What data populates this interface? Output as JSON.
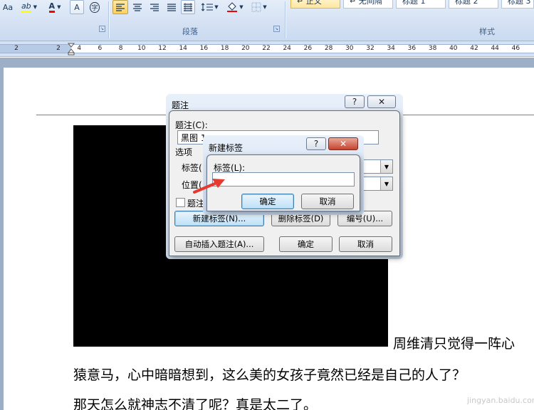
{
  "ribbon": {
    "font_group": {
      "change_case_label": "Aa",
      "highlight_label": "ab",
      "font_color_label": "A",
      "char_shading_label": "A",
      "enclose_label": "字"
    },
    "paragraph_group": {
      "label": "段落"
    },
    "styles_group": {
      "label": "样式",
      "items": [
        "↵ 正文",
        "↵ 无间隔",
        "标题 1",
        "标题 2",
        "标题 3"
      ]
    },
    "colors": {
      "highlight": "#ffff00",
      "font_color": "#ff0000",
      "selected_style": "#ffe7a1"
    }
  },
  "ruler": {
    "ticks": [
      "2",
      "2",
      "4",
      "6",
      "8",
      "10",
      "12",
      "14",
      "16",
      "18",
      "20",
      "22",
      "24",
      "26",
      "28",
      "30",
      "32",
      "34",
      "36",
      "38",
      "40",
      "42",
      "44",
      "46"
    ]
  },
  "caption_dialog": {
    "title": "题注",
    "help_label": "?",
    "close_label": "✕",
    "caption_label": "题注(C):",
    "caption_value": "黑图 1",
    "options_label": "选项",
    "label_label": "标签(",
    "position_label": "位置(",
    "exclude_label": "题注",
    "new_label_button": "新建标签(N)...",
    "delete_label_button": "删除标签(D)",
    "numbering_button": "编号(U)...",
    "autocaption_button": "自动插入题注(A)...",
    "ok_button": "确定",
    "cancel_button": "取消"
  },
  "new_label_dialog": {
    "title": "新建标签",
    "help_label": "?",
    "close_label": "✕",
    "label_label": "标签(L):",
    "label_value": "",
    "ok_button": "确定",
    "cancel_button": "取消"
  },
  "document": {
    "line1": "周维清只觉得一阵心",
    "line2": "猿意马，心中暗暗想到，这么美的女孩子竟然已经是自己的人了？",
    "line3": "那天怎么就神志不清了呢？真是太二了。"
  },
  "watermark": {
    "site": "jingyan.baidu.com"
  },
  "annotation": {
    "arrow_color": "#e53a2f"
  }
}
